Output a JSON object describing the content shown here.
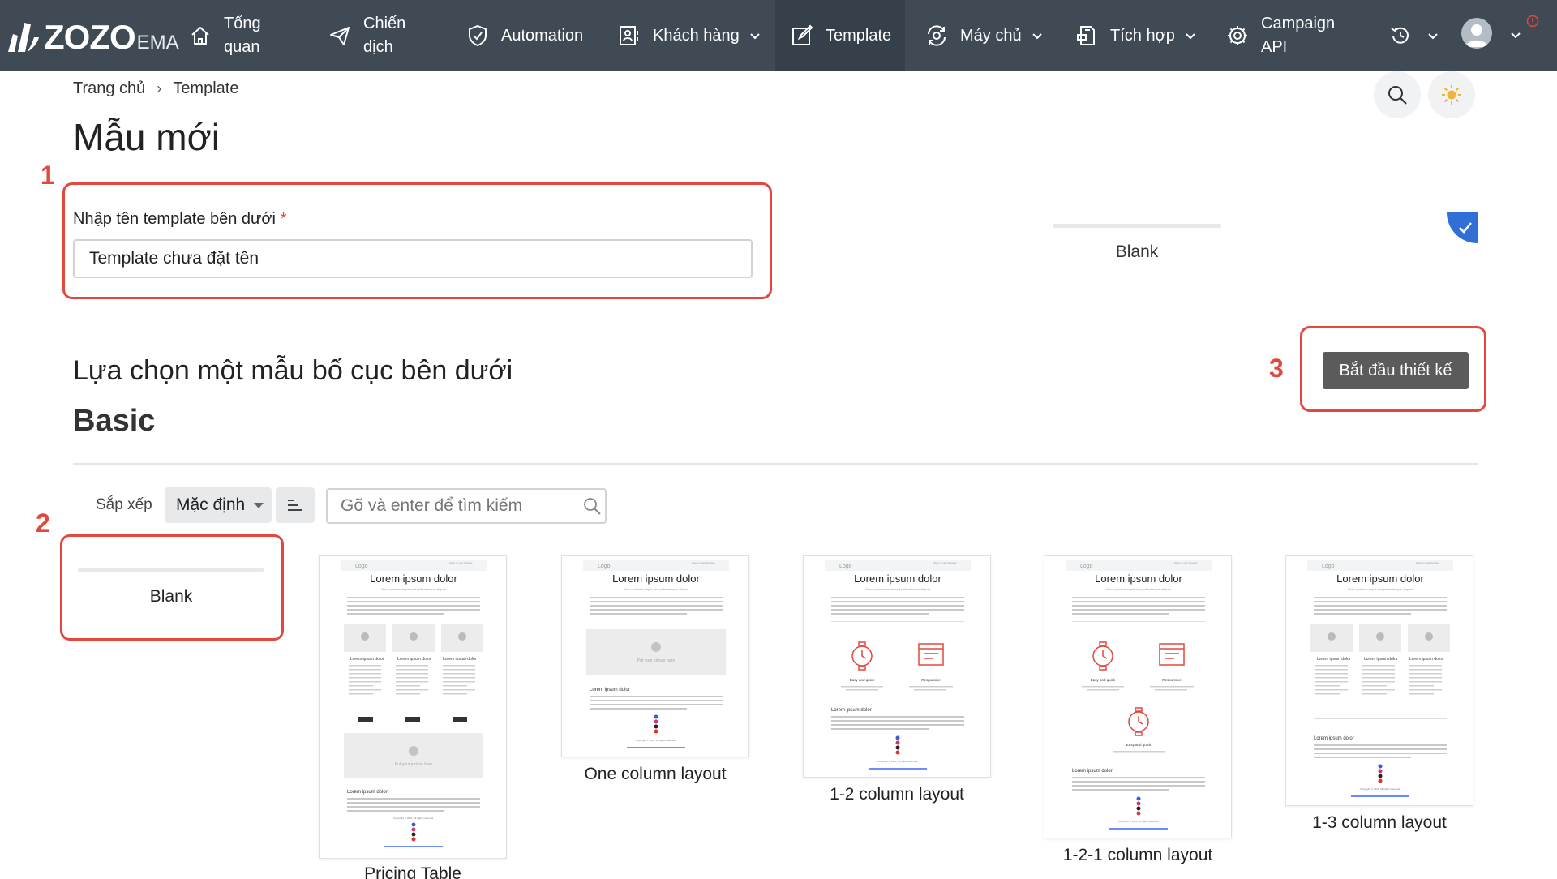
{
  "nav": {
    "logo_main": "ZOZO",
    "logo_sub": "EMA",
    "items": [
      {
        "label": "Tổng\nquan",
        "icon": "home-icon"
      },
      {
        "label": "Chiến\ndịch",
        "icon": "paper-plane-icon"
      },
      {
        "label": "Automation",
        "icon": "automation-icon"
      },
      {
        "label": "Khách hàng",
        "icon": "contacts-icon"
      },
      {
        "label": "Template",
        "icon": "edit-icon"
      },
      {
        "label": "Máy chủ",
        "icon": "server-sync-icon"
      },
      {
        "label": "Tích hợp",
        "icon": "integration-icon"
      },
      {
        "label": "Campaign\nAPI",
        "icon": "api-gear-icon"
      }
    ]
  },
  "breadcrumb": {
    "home": "Trang chủ",
    "separator": "›",
    "current": "Template"
  },
  "page": {
    "title": "Mẫu mới"
  },
  "steps": {
    "one": "1",
    "two": "2",
    "three": "3"
  },
  "form": {
    "label": "Nhập tên template bên dưới",
    "required_mark": "*",
    "value": "Template chưa đặt tên"
  },
  "preview": {
    "label": "Blank"
  },
  "section": {
    "title": "Lựa chọn một mẫu bố cục bên dưới",
    "category": "Basic"
  },
  "actions": {
    "start": "Bắt đầu thiết kế"
  },
  "filters": {
    "sort_label": "Sắp xếp",
    "sort_value": "Mặc định",
    "search_placeholder": "Gõ và enter để tìm kiếm"
  },
  "templates": {
    "blank": "Blank",
    "pricing": "Pricing Table",
    "one_col": "One column layout",
    "one_two": "1-2 column layout",
    "one_two_one": "1-2-1 column layout",
    "one_three": "1-3 column layout"
  },
  "thumb_text": {
    "logo": "Logo",
    "open_browser": "Open in your browser",
    "heading": "Lorem ipsum dolor",
    "subheading": "Nunc pulvinar turpis sed pellentesque aliquet",
    "picture": "Put your picture here",
    "col_title": "Lorem ipsum dolor",
    "easy": "Easy and quick",
    "responsive": "Responsive",
    "copyright": "Copyright © 2021, All rights reserved."
  },
  "colors": {
    "nav_bg": "#3f4a55",
    "highlight": "#e2483d",
    "primary_btn": "#5b5b5b",
    "check_badge": "#2f6fd6"
  }
}
